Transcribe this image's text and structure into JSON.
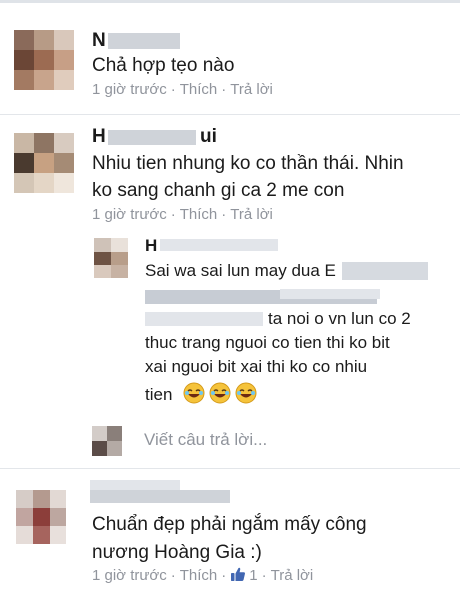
{
  "comments": [
    {
      "author_visible": "N",
      "text": "Chả hợp tẹo nào",
      "time": "1 giờ trước",
      "like": "Thích",
      "reply": "Trả lời"
    },
    {
      "author_visible_start": "H",
      "author_visible_end": "ui",
      "text_line1": "Nhiu tien nhung ko co thần thái. Nhin",
      "text_line2": "ko sang chanh gi ca 2 me con",
      "time": "1 giờ trước",
      "like": "Thích",
      "reply": "Trả lời"
    },
    {
      "author_visible": "H",
      "line1": "Sai wa sai lun may dua E",
      "line3": "ta noi o vn lun co 2",
      "line4": "thuc trang nguoi co tien thi ko bit",
      "line5": "xai nguoi bit xai thi ko co nhiu",
      "line6": "tien"
    },
    {
      "text_line1": "Chuẩn đẹp phải ngắm mấy công",
      "text_line2": "nương Hoàng Gia :)",
      "time": "1 giờ trước",
      "like": "Thích",
      "like_count": "1",
      "reply": "Trả lời"
    }
  ],
  "reply_placeholder": "Viết câu trả lời...",
  "separator": "·",
  "colors": {
    "meta": "#90949c",
    "text": "#1b1b1b",
    "like_blue": "#4267b2"
  },
  "icons": [
    "laughing-emoji-icon",
    "thumbs-up-icon"
  ]
}
